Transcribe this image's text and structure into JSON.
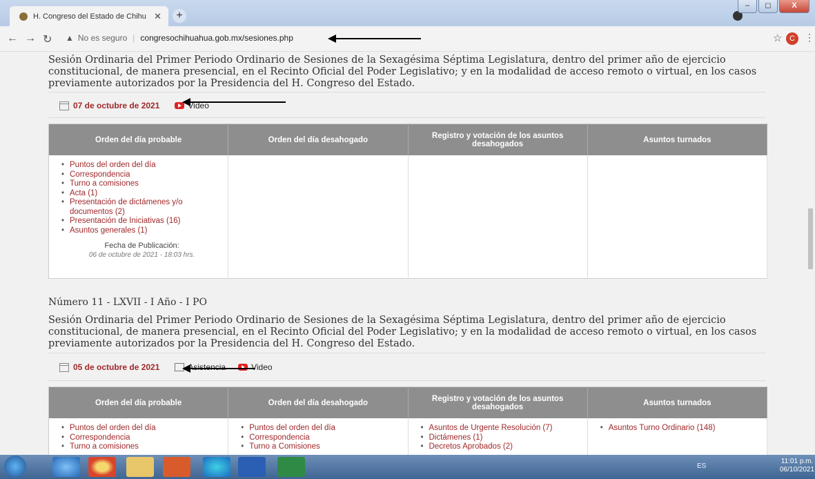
{
  "browser": {
    "tab_title": "H. Congreso del Estado de Chihu",
    "tab_close": "✕",
    "new_tab": "+",
    "security_warning": "No es seguro",
    "url": "congresochihuahua.gob.mx/sesiones.php",
    "profile_initial": "C",
    "window_buttons": [
      "‒",
      "◻",
      "X"
    ]
  },
  "session1": {
    "description": "Sesión Ordinaria del Primer Periodo Ordinario de Sesiones de la Sexagésima Séptima Legislatura, dentro del primer año de ejercicio constitucional, de manera presencial, en el Recinto Oficial del Poder Legislativo; y en la modalidad de acceso remoto o virtual, en los casos previamente autorizados por la Presidencia del H. Congreso del Estado.",
    "date": "07 de octubre de 2021",
    "video": "Video",
    "headers": [
      "Orden del día probable",
      "Orden del día desahogado",
      "Registro y votación de los asuntos desahogados",
      "Asuntos turnados"
    ],
    "probable": [
      "Puntos del orden del día",
      "Correspondencia",
      "Turno a comisiones",
      "Acta (1)",
      "Presentación de dictámenes y/o documentos (2)",
      "Presentación de Iniciativas (16)",
      "Asuntos generales (1)"
    ],
    "pub_label": "Fecha de Publicación:",
    "pub_value": "06 de octubre de 2021 - 18:03 hrs."
  },
  "session2": {
    "number": "Número 11 - LXVII - I Año - I PO",
    "description": "Sesión Ordinaria del Primer Periodo Ordinario de Sesiones de la Sexagésima Séptima Legislatura, dentro del primer año de ejercicio constitucional, de manera presencial, en el Recinto Oficial del Poder Legislativo; y en la modalidad de acceso remoto o virtual, en los casos previamente autorizados por la Presidencia del H. Congreso del Estado.",
    "date": "05 de octubre de 2021",
    "asistencia": "Asistencia",
    "video": "Video",
    "headers": [
      "Orden del día probable",
      "Orden del día desahogado",
      "Registro y votación de los asuntos desahogados",
      "Asuntos turnados"
    ],
    "probable": [
      "Puntos del orden del día",
      "Correspondencia",
      "Turno a comisiones"
    ],
    "desahogado": [
      "Puntos del orden del día",
      "Correspondencia",
      "Turno a Comisiones"
    ],
    "registro": [
      "Asuntos de Urgente Resolución (7)",
      "Dictámenes (1)",
      "Decretos Aprobados (2)"
    ],
    "turnados": [
      "Asuntos Turno Ordinario (148)"
    ]
  },
  "taskbar": {
    "language": "ES",
    "time": "11:01 p.m.",
    "date": "06/10/2021"
  },
  "colors": {
    "link_red": "#a0282a",
    "table_header": "#8e8e8e"
  }
}
